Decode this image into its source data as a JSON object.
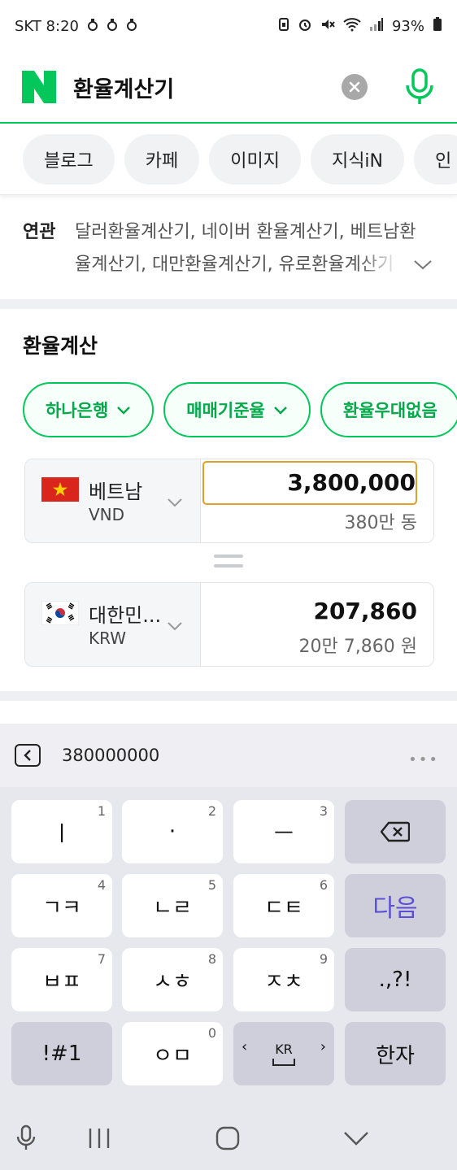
{
  "status_bar": {
    "carrier_time": "SKT 8:20",
    "notification_icons": [
      "talk-icon",
      "talk-icon",
      "talk-icon"
    ],
    "battery": "93%",
    "system_icons": [
      "battery-saver-icon",
      "alarm-icon",
      "mute-icon",
      "wifi-icon",
      "signal-icon",
      "battery-icon"
    ]
  },
  "search": {
    "logo": "N",
    "query": "환율계산기",
    "clear_icon": "close-icon",
    "voice_icon": "microphone-icon"
  },
  "tabs": [
    "블로그",
    "카페",
    "이미지",
    "지식iN",
    "인"
  ],
  "related": {
    "label": "연관",
    "text": "달러환율계산기, 네이버 환율계산기, 베트남환율계산기, 대만환율계산기, 유로환율계산기"
  },
  "converter": {
    "title": "환율계산",
    "pills": [
      "하나은행",
      "매매기준율",
      "환율우대없음"
    ],
    "from": {
      "name": "베트남",
      "code": "VND",
      "amount": "3,800,000",
      "amount_korean": "380만 동"
    },
    "to": {
      "name": "대한민...",
      "code": "KRW",
      "amount": "207,860",
      "amount_korean": "20만 7,860 원"
    }
  },
  "keyboard": {
    "input_preview": "380000000",
    "rows": [
      [
        {
          "label": "ㅣ",
          "hint": "1"
        },
        {
          "label": "·",
          "hint": "2"
        },
        {
          "label": "ㅡ",
          "hint": "3"
        },
        {
          "label": "backspace-icon",
          "hint": ""
        }
      ],
      [
        {
          "label": "ㄱㅋ",
          "hint": "4"
        },
        {
          "label": "ㄴㄹ",
          "hint": "5"
        },
        {
          "label": "ㄷㅌ",
          "hint": "6"
        },
        {
          "label": "다음",
          "hint": ""
        }
      ],
      [
        {
          "label": "ㅂㅍ",
          "hint": "7"
        },
        {
          "label": "ㅅㅎ",
          "hint": "8"
        },
        {
          "label": "ㅈㅊ",
          "hint": "9"
        },
        {
          "label": ".,?!",
          "hint": ""
        }
      ],
      [
        {
          "label": "!#1",
          "hint": ""
        },
        {
          "label": "ㅇㅁ",
          "hint": "0"
        },
        {
          "label": "KR",
          "hint": ""
        },
        {
          "label": "한자",
          "hint": ""
        }
      ]
    ]
  },
  "colors": {
    "naver_green": "#03c75a",
    "focus_border": "#e0a12b",
    "next_key": "#5b4fd6"
  }
}
